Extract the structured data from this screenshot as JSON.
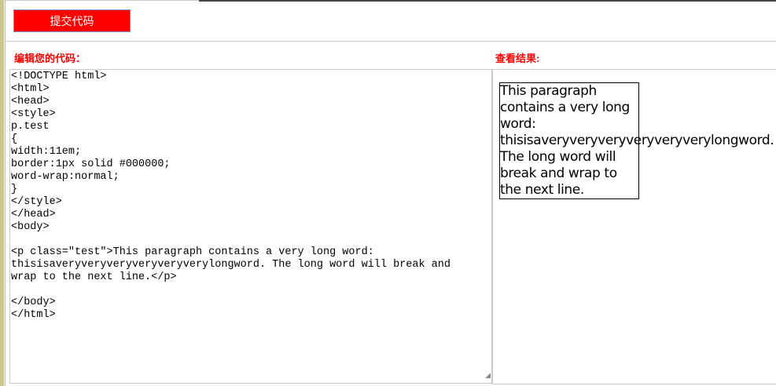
{
  "toolbar": {
    "submit_label": "提交代码"
  },
  "editor": {
    "label": "编辑您的代码：",
    "code": "<!DOCTYPE html>\n<html>\n<head>\n<style>\np.test\n{\nwidth:11em;\nborder:1px solid #000000;\nword-wrap:normal;\n}\n</style>\n</head>\n<body>\n\n<p class=\"test\">This paragraph contains a very long word:\nthisisaveryveryveryveryveryverylongword. The long word will break and\nwrap to the next line.</p>\n\n</body>\n</html>"
  },
  "result": {
    "label": "查看结果:",
    "paragraph": "This paragraph contains a very long word: thisisaveryveryveryveryveryverylongword. The long word will break and wrap to the next line."
  }
}
